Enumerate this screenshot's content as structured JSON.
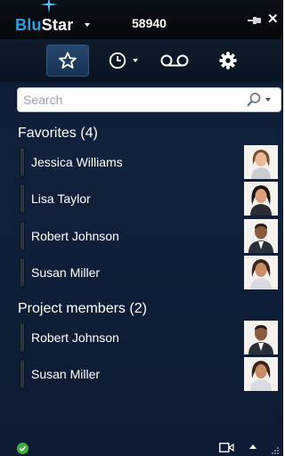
{
  "app": {
    "logo_blu": "Blu",
    "logo_star": "Star",
    "account_number": "58940",
    "close_symbol": "✕"
  },
  "toolbar": {
    "items": [
      {
        "icon": "star-icon",
        "active": true
      },
      {
        "icon": "clock-icon",
        "has_dropdown": true
      },
      {
        "icon": "voicemail-icon"
      },
      {
        "icon": "gear-icon"
      }
    ]
  },
  "search": {
    "placeholder": "Search",
    "value": ""
  },
  "favorites": {
    "title": "Favorites (4)",
    "contacts": [
      {
        "name": "Jessica Williams",
        "avatar": "female"
      },
      {
        "name": "Lisa Taylor",
        "avatar": "female"
      },
      {
        "name": "Robert Johnson",
        "avatar": "male"
      },
      {
        "name": "Susan Miller",
        "avatar": "female"
      }
    ]
  },
  "project_members": {
    "title": "Project members (2)",
    "contacts": [
      {
        "name": "Robert Johnson",
        "avatar": "male"
      },
      {
        "name": "Susan Miller",
        "avatar": "female"
      }
    ]
  },
  "status": {
    "presence": "available",
    "color": "#3fae3a"
  },
  "colors": {
    "brand_blue": "#2d9fe0",
    "background": "#0d1b33"
  }
}
